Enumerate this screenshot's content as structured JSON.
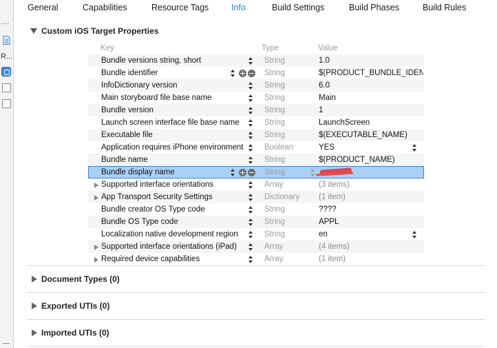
{
  "tabs": [
    {
      "label": "General"
    },
    {
      "label": "Capabilities"
    },
    {
      "label": "Resource Tags"
    },
    {
      "label": "Info",
      "active": true
    },
    {
      "label": "Build Settings"
    },
    {
      "label": "Build Phases"
    },
    {
      "label": "Build Rules"
    }
  ],
  "left_strip": {
    "dots": "...",
    "label": "R..."
  },
  "section_main": {
    "title": "Custom iOS Target Properties"
  },
  "table": {
    "headers": {
      "key": "Key",
      "type": "Type",
      "value": "Value"
    },
    "rows": [
      {
        "key": "Bundle versions string, short",
        "type": "String",
        "value": "1.0"
      },
      {
        "key": "Bundle identifier",
        "type": "String",
        "value": "$(PRODUCT_BUNDLE_IDENTIFIER)"
      },
      {
        "key": "InfoDictionary version",
        "type": "String",
        "value": "6.0"
      },
      {
        "key": "Main storyboard file base name",
        "type": "String",
        "value": "Main"
      },
      {
        "key": "Bundle version",
        "type": "String",
        "value": "1"
      },
      {
        "key": "Launch screen interface file base name",
        "type": "String",
        "value": "LaunchScreen"
      },
      {
        "key": "Executable file",
        "type": "String",
        "value": "$(EXECUTABLE_NAME)"
      },
      {
        "key": "Application requires iPhone environment",
        "type": "Boolean",
        "value": "YES"
      },
      {
        "key": "Bundle name",
        "type": "String",
        "value": "$(PRODUCT_NAME)"
      },
      {
        "key": "Bundle display name",
        "type": "String",
        "value": ""
      },
      {
        "key": "Supported interface orientations",
        "type": "Array",
        "value": "(3 items)"
      },
      {
        "key": "App Transport Security Settings",
        "type": "Dictionary",
        "value": "(1 item)"
      },
      {
        "key": "Bundle creator OS Type code",
        "type": "String",
        "value": "????"
      },
      {
        "key": "Bundle OS Type code",
        "type": "String",
        "value": "APPL"
      },
      {
        "key": "Localization native development region",
        "type": "String",
        "value": "en"
      },
      {
        "key": "Supported interface orientations (iPad)",
        "type": "Array",
        "value": "(4 items)"
      },
      {
        "key": "Required device capabilities",
        "type": "Array",
        "value": "(1 item)"
      }
    ]
  },
  "sections": [
    {
      "title": "Document Types (0)"
    },
    {
      "title": "Exported UTIs (0)"
    },
    {
      "title": "Imported UTIs (0)"
    }
  ],
  "icons": [
    "document-icon",
    "app-target-icon",
    "folder-icon",
    "disclosure-triangle-icon",
    "plus-icon",
    "minus-icon",
    "stepper-icon"
  ],
  "colors": {
    "accent": "#2a7fd9",
    "selection": "#a9d1f5",
    "selection_border": "#3b7fd1",
    "redaction": "#e0393e"
  }
}
